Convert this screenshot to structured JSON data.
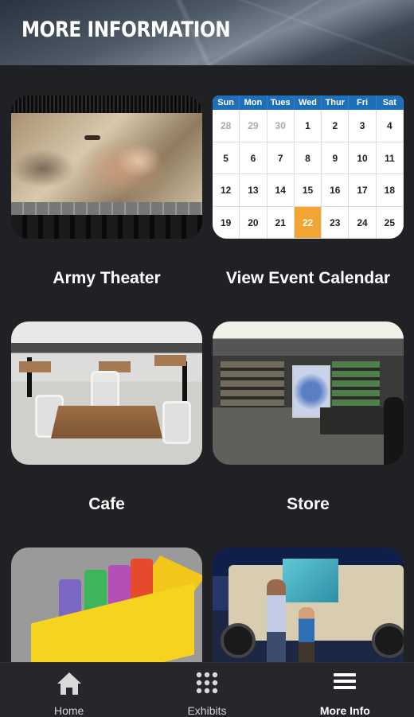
{
  "header": {
    "title": "MORE INFORMATION"
  },
  "cards": [
    {
      "label": "Army Theater"
    },
    {
      "label": "View Event Calendar"
    },
    {
      "label": "Cafe"
    },
    {
      "label": "Store"
    },
    {
      "label": ""
    },
    {
      "label": ""
    }
  ],
  "calendar": {
    "days": [
      "Sun",
      "Mon",
      "Tues",
      "Wed",
      "Thur",
      "Fri",
      "Sat"
    ],
    "dates": [
      "28",
      "29",
      "30",
      "1",
      "2",
      "3",
      "4",
      "5",
      "6",
      "7",
      "8",
      "9",
      "10",
      "11",
      "12",
      "13",
      "14",
      "15",
      "16",
      "17",
      "18",
      "19",
      "20",
      "21",
      "22",
      "23",
      "24",
      "25"
    ],
    "muted_dates": [
      "28",
      "29",
      "30"
    ],
    "highlighted_date": "22",
    "colors": {
      "header": "#1f6fb8",
      "highlight": "#f2a533"
    }
  },
  "bottom_nav": {
    "items": [
      {
        "label": "Home",
        "icon": "home-icon"
      },
      {
        "label": "Exhibits",
        "icon": "grid-icon"
      },
      {
        "label": "More Info",
        "icon": "menu-icon",
        "active": true
      }
    ]
  }
}
